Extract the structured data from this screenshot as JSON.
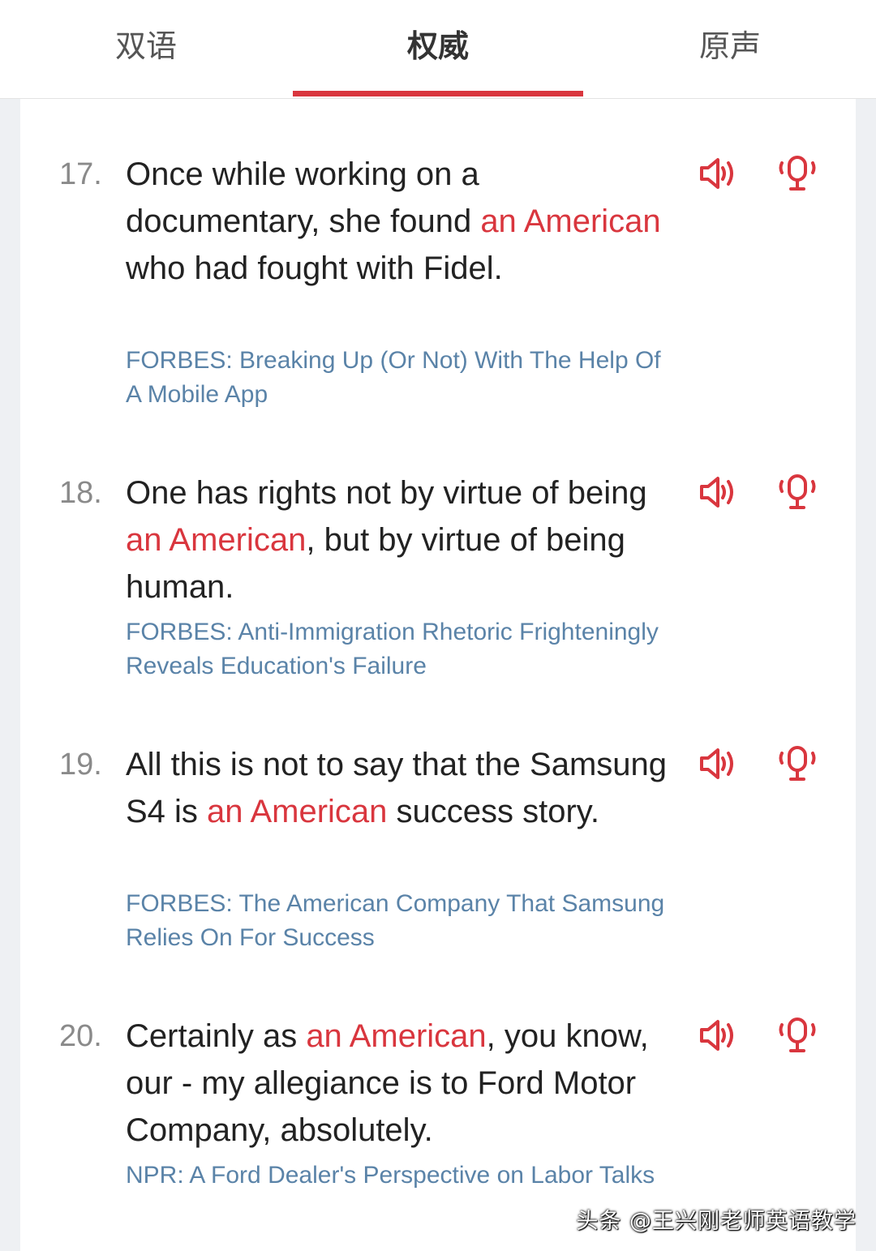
{
  "tabs": [
    {
      "label": "双语",
      "active": false
    },
    {
      "label": "权威",
      "active": true
    },
    {
      "label": "原声",
      "active": false
    }
  ],
  "colors": {
    "accent": "#d9363e",
    "source": "#5a83a8",
    "text": "#222222",
    "number": "#8a8a8a"
  },
  "sentences": [
    {
      "number": "17.",
      "parts": [
        {
          "text": "Once while working on a documentary, she found ",
          "hl": false
        },
        {
          "text": "an American",
          "hl": true
        },
        {
          "text": " who had fought with Fidel.",
          "hl": false
        }
      ],
      "source": "FORBES: Breaking Up (Or Not) With The Help Of A Mobile App",
      "speaker_icon": "speaker-icon",
      "mic_icon": "microphone-icon"
    },
    {
      "number": "18.",
      "parts": [
        {
          "text": "One has rights not by virtue of being ",
          "hl": false
        },
        {
          "text": "an American",
          "hl": true
        },
        {
          "text": ", but by virtue of being human.",
          "hl": false
        }
      ],
      "source": "FORBES: Anti-Immigration Rhetoric Frighteningly Reveals Education's Failure",
      "speaker_icon": "speaker-icon",
      "mic_icon": "microphone-icon"
    },
    {
      "number": "19.",
      "parts": [
        {
          "text": "All this is not to say that the Samsung S4 is ",
          "hl": false
        },
        {
          "text": "an American",
          "hl": true
        },
        {
          "text": " success story.",
          "hl": false
        }
      ],
      "source": "FORBES: The American Company That Samsung Relies On For Success",
      "speaker_icon": "speaker-icon",
      "mic_icon": "microphone-icon"
    },
    {
      "number": "20.",
      "parts": [
        {
          "text": "Certainly as ",
          "hl": false
        },
        {
          "text": "an American",
          "hl": true
        },
        {
          "text": ", you know, our - my allegiance is to Ford Motor Company, absolutely.",
          "hl": false
        }
      ],
      "source": "NPR: A Ford Dealer's Perspective on Labor Talks",
      "speaker_icon": "speaker-icon",
      "mic_icon": "microphone-icon"
    }
  ],
  "watermark": "头条 @王兴刚老师英语教学"
}
